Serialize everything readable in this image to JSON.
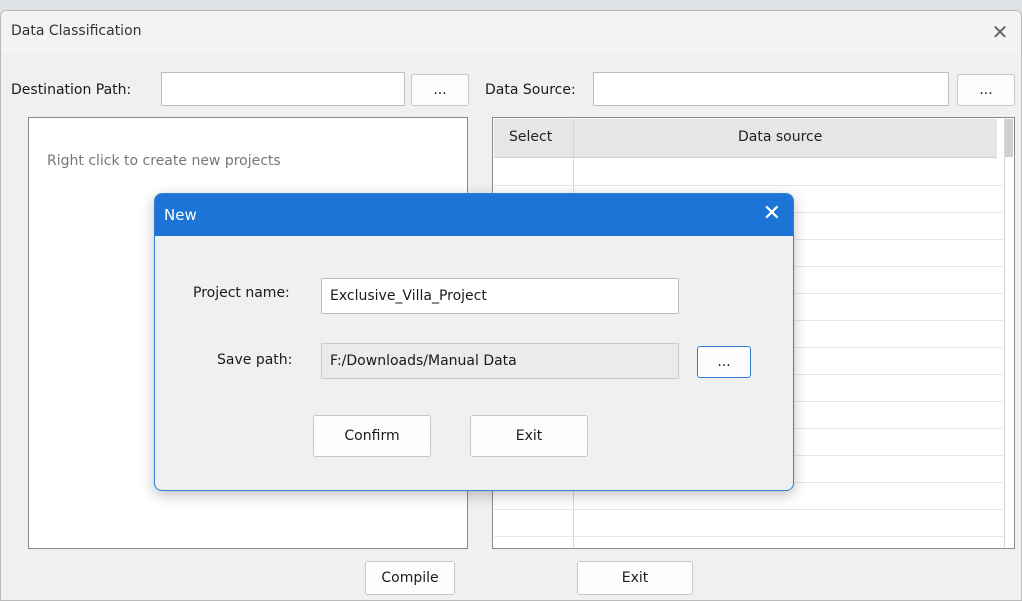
{
  "window": {
    "title": "Data Classification",
    "close_glyph": "✕"
  },
  "toolbar": {
    "destination_label": "Destination Path:",
    "destination_value": "",
    "destination_browse": "...",
    "source_label": "Data Source:",
    "source_value": "",
    "source_browse": "..."
  },
  "projects_panel": {
    "hint": "Right click to create new projects"
  },
  "source_table": {
    "columns": [
      "Select",
      "Data source"
    ],
    "rows": []
  },
  "footer": {
    "compile_label": "Compile",
    "exit_label": "Exit"
  },
  "dialog": {
    "title": "New",
    "close_glyph": "✕",
    "project_name_label": "Project name:",
    "project_name_value": "Exclusive_Villa_Project",
    "save_path_label": "Save path:",
    "save_path_value": "F:/Downloads/Manual Data",
    "browse_label": "...",
    "confirm_label": "Confirm",
    "exit_label": "Exit"
  },
  "colors": {
    "dialog_title_bg": "#1b74d6",
    "window_bg": "#f0f0f0"
  }
}
